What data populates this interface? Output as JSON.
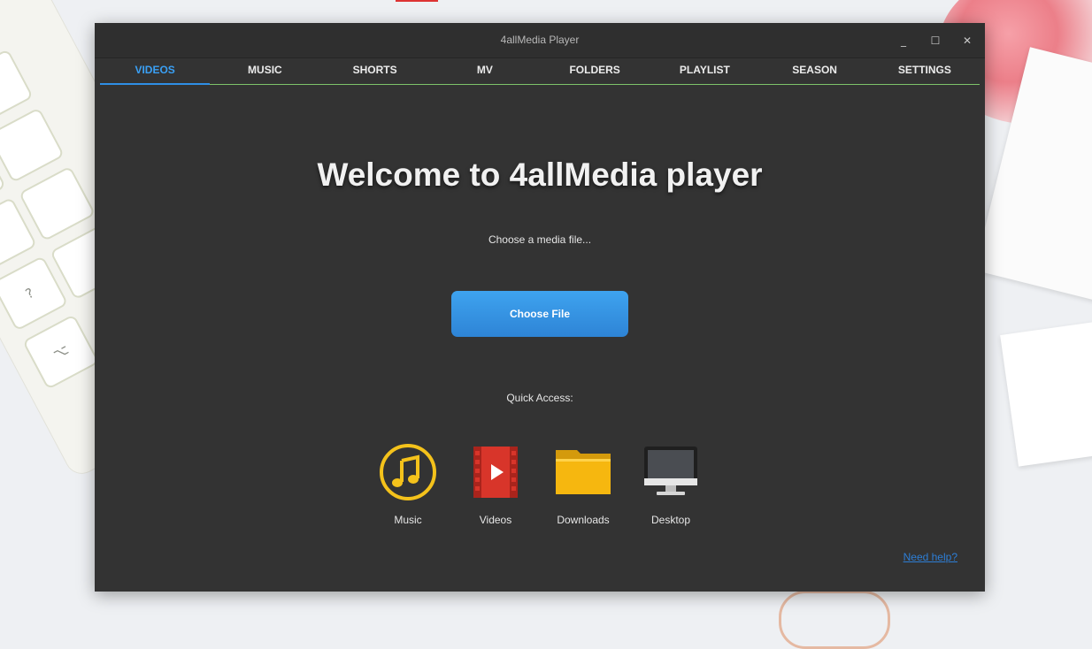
{
  "window": {
    "title": "4allMedia Player",
    "controls": {
      "minimize": "_",
      "maximize": "☐",
      "close": "✕"
    }
  },
  "tabs": [
    {
      "label": "VIDEOS",
      "active": true
    },
    {
      "label": "MUSIC"
    },
    {
      "label": "SHORTS"
    },
    {
      "label": "MV"
    },
    {
      "label": "FOLDERS"
    },
    {
      "label": "PLAYLIST"
    },
    {
      "label": "SEASON"
    },
    {
      "label": "SETTINGS"
    }
  ],
  "main": {
    "heading": "Welcome to 4allMedia player",
    "choose_prompt": "Choose a media file...",
    "choose_button": "Choose File",
    "quick_access_label": "Quick Access:",
    "quick_access": [
      {
        "label": "Music",
        "icon": "music-note-icon"
      },
      {
        "label": "Videos",
        "icon": "video-film-icon"
      },
      {
        "label": "Downloads",
        "icon": "folder-icon"
      },
      {
        "label": "Desktop",
        "icon": "monitor-icon"
      }
    ],
    "help_link": "Need help?"
  },
  "colors": {
    "accent": "#3aa0f5",
    "tab_underline": "#7ec36a",
    "window_bg": "#333333",
    "button": "#3391e0",
    "link": "#2d7ed6"
  }
}
